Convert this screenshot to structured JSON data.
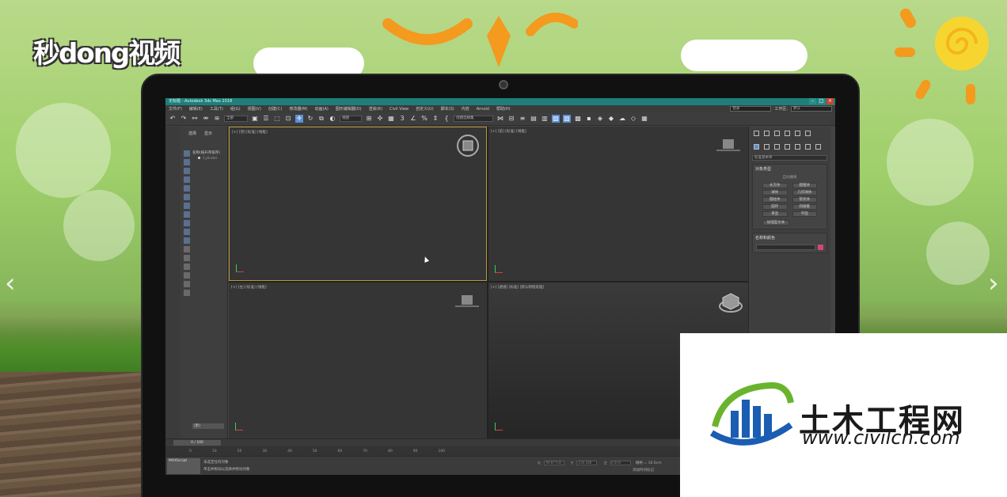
{
  "brand": {
    "text": "秒dong视频"
  },
  "nav": {
    "prev_glyph": "‹",
    "next_glyph": "›"
  },
  "app": {
    "title": "无标题 - Autodesk 3ds Max 2018",
    "menu": [
      "文件(F)",
      "编辑(E)",
      "工具(T)",
      "组(G)",
      "视图(V)",
      "创建(C)",
      "修改器(M)",
      "动画(A)",
      "图形编辑器(D)",
      "渲染(R)",
      "Civil View",
      "自定义(U)",
      "脚本(S)",
      "内容",
      "Arnold",
      "帮助(H)"
    ],
    "user_field": "登录",
    "workspace_label": "工作区:",
    "workspace_value": "默认",
    "toolbar": {
      "selection_filter": "全部",
      "ref_coord": "视图",
      "named_selection": "创建选择集"
    },
    "scene_explorer": {
      "tab_select": "选择",
      "tab_display": "显示",
      "column_header": "名称(按升序排序)",
      "item": "Cylinder",
      "footer_dropdown": "(默)"
    },
    "viewports": [
      {
        "label": "[+] [顶] [标准] [线框]"
      },
      {
        "label": "[+] [前] [标准] [线框]"
      },
      {
        "label": "[+] [左] [标准] [线框]"
      },
      {
        "label": "[+] [透视] [标准] [默认明暗处理]"
      }
    ],
    "command_panel": {
      "category_dropdown": "标准基本体",
      "object_type_title": "对象类型",
      "autogrid_label": "自动栅格",
      "primitives": [
        "长方体",
        "圆锥体",
        "球体",
        "几何球体",
        "圆柱体",
        "管状体",
        "圆环",
        "四棱锥",
        "茶壶",
        "平面"
      ],
      "extra_primitive": "加强型文本",
      "name_color_title": "名称和颜色",
      "swatch_color": "#d0477b"
    },
    "timeline": {
      "frame_display": "0 / 100"
    },
    "ruler_ticks": [
      "0",
      "10",
      "20",
      "30",
      "40",
      "50",
      "60",
      "70",
      "80",
      "90",
      "100"
    ],
    "status": {
      "maxscript_label": "MAXScript",
      "line1": "未选定任何对象",
      "line2": "单击并拖动以选择并移动对象",
      "x_label": "X:",
      "x_value": "-90.877cm",
      "y_label": "Y:",
      "y_value": "-230.438",
      "z_label": "Z:",
      "z_value": "0.0cm",
      "grid_label": "栅格 = 10.0cm",
      "add_key_label": "添加时间标记"
    }
  },
  "watermark": {
    "cn_text": "土木工程网",
    "url_text": "www.civilcn.com",
    "colors": {
      "blue": "#1a5db3",
      "green": "#6ab42d"
    }
  }
}
